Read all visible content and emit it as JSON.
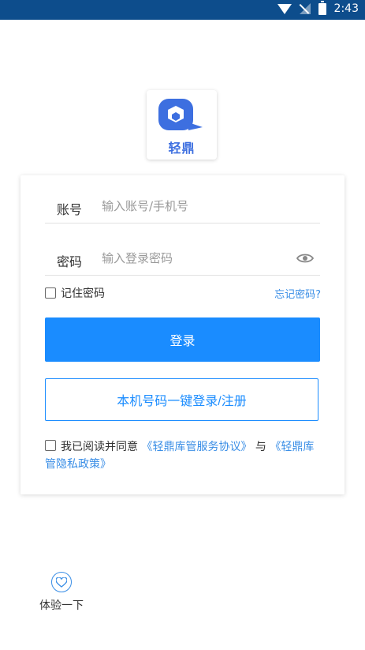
{
  "status_bar": {
    "time": "2:43"
  },
  "logo": {
    "brand_text": "轻鼎"
  },
  "login_form": {
    "account_label": "账号",
    "account_placeholder": "输入账号/手机号",
    "password_label": "密码",
    "password_placeholder": "输入登录密码",
    "remember_label": "记住密码",
    "forgot_link": "忘记密码?",
    "login_button": "登录",
    "one_click_button": "本机号码一键登录/注册"
  },
  "agreement": {
    "prefix": "我已阅读并同意",
    "service_link": "《轻鼎库管服务协议》",
    "conjunction": "与",
    "privacy_link": "《轻鼎库管隐私政策》"
  },
  "trial": {
    "label": "体验一下"
  },
  "colors": {
    "status_bar": "#0d4d8c",
    "primary": "#1a8cff",
    "link": "#3a8ee6",
    "logo": "#3d6fe0"
  }
}
